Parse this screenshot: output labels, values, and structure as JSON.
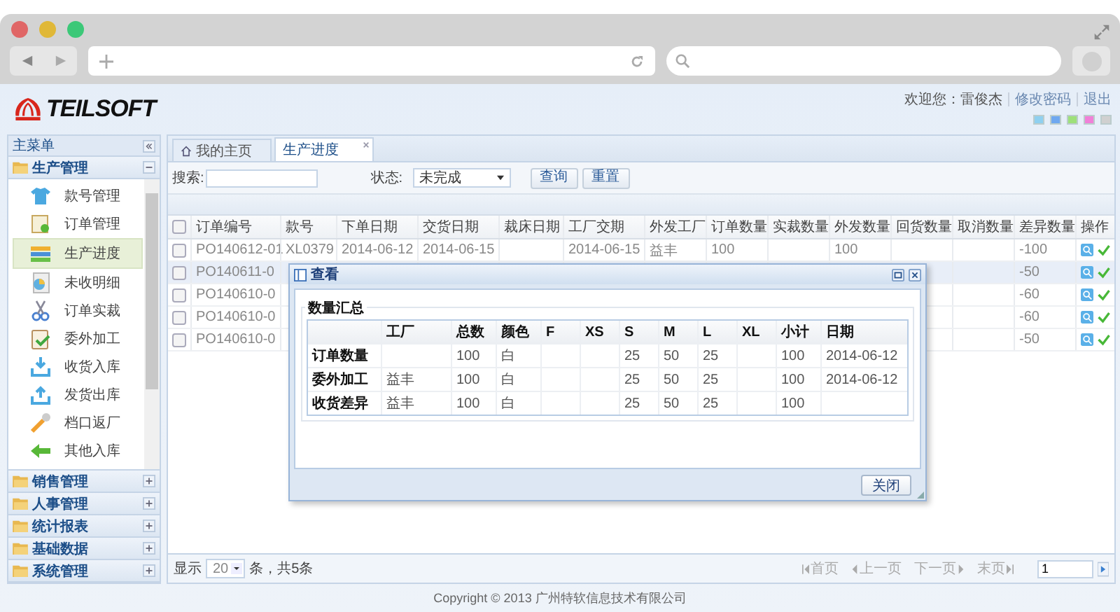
{
  "header": {
    "logo_text": "TEILSOFT",
    "welcome": "欢迎您：雷俊杰",
    "links": [
      "修改密码",
      "退出"
    ]
  },
  "sidebar": {
    "title": "主菜单",
    "sections": [
      {
        "label": "生产管理",
        "expanded": true,
        "items": [
          {
            "label": "款号管理",
            "selected": false
          },
          {
            "label": "订单管理",
            "selected": false
          },
          {
            "label": "生产进度",
            "selected": true
          },
          {
            "label": "未收明细",
            "selected": false
          },
          {
            "label": "订单实裁",
            "selected": false
          },
          {
            "label": "委外加工",
            "selected": false
          },
          {
            "label": "收货入库",
            "selected": false
          },
          {
            "label": "发货出库",
            "selected": false
          },
          {
            "label": "档口返厂",
            "selected": false
          },
          {
            "label": "其他入库",
            "selected": false
          }
        ]
      },
      {
        "label": "销售管理",
        "expanded": false
      },
      {
        "label": "人事管理",
        "expanded": false
      },
      {
        "label": "统计报表",
        "expanded": false
      },
      {
        "label": "基础数据",
        "expanded": false
      },
      {
        "label": "系统管理",
        "expanded": false
      }
    ]
  },
  "tabs": [
    {
      "label": "我的主页",
      "selected": false,
      "closable": false
    },
    {
      "label": "生产进度",
      "selected": true,
      "closable": true
    }
  ],
  "toolbar": {
    "search_label": "搜索:",
    "status_label": "状态:",
    "status_value": "未完成",
    "buttons": [
      "查询",
      "重置"
    ]
  },
  "table": {
    "select_all_checked": false,
    "columns": [
      "订单编号",
      "款号",
      "下单日期",
      "交货日期",
      "裁床日期",
      "工厂交期",
      "外发工厂",
      "订单数量",
      "实裁数量",
      "外发数量",
      "回货数量",
      "取消数量",
      "差异数量",
      "操作"
    ],
    "rows": [
      {
        "checked": false,
        "selected": false,
        "order_no": "PO140612-01",
        "style_no": "XL0379",
        "order_date": "2014-06-12",
        "delivery_date": "2014-06-15",
        "factory_date": "2014-06-15",
        "outsource_factory": "益丰",
        "order_qty": "100",
        "outsource_qty": "100",
        "diff_qty": "-100"
      },
      {
        "checked": false,
        "selected": true,
        "order_no": "PO140611-0",
        "diff_qty": "-50"
      },
      {
        "checked": false,
        "selected": false,
        "order_no": "PO140610-0",
        "diff_qty": "-60"
      },
      {
        "checked": false,
        "selected": false,
        "order_no": "PO140610-0",
        "diff_qty": "-60"
      },
      {
        "checked": false,
        "selected": false,
        "order_no": "PO140610-0",
        "diff_qty": "-50"
      }
    ]
  },
  "pager": {
    "show_label": "显示",
    "page_size": "20",
    "count_text": "条，共5条",
    "first": "首页",
    "prev": "上一页",
    "next": "下一页",
    "last": "末页",
    "page": "1"
  },
  "dialog": {
    "title": "查看",
    "legend": "数量汇总",
    "columns": [
      "工厂",
      "总数",
      "颜色",
      "F",
      "XS",
      "S",
      "M",
      "L",
      "XL",
      "小计",
      "日期"
    ],
    "rows": [
      {
        "label": "订单数量",
        "total": "100",
        "shade": "白",
        "S": "25",
        "M": "50",
        "L": "25",
        "subtotal": "100",
        "date": "2014-06-12"
      },
      {
        "label": "委外加工",
        "factory": "益丰",
        "total": "100",
        "shade": "白",
        "S": "25",
        "M": "50",
        "L": "25",
        "subtotal": "100",
        "date": "2014-06-12"
      },
      {
        "label": "收货差异",
        "factory": "益丰",
        "total": "100",
        "shade": "白",
        "S": "25",
        "M": "50",
        "L": "25",
        "subtotal": "100"
      }
    ],
    "button": "关闭"
  },
  "footer": {
    "copyright": "Copyright © 2013 广州特软信息技术有限公司"
  }
}
